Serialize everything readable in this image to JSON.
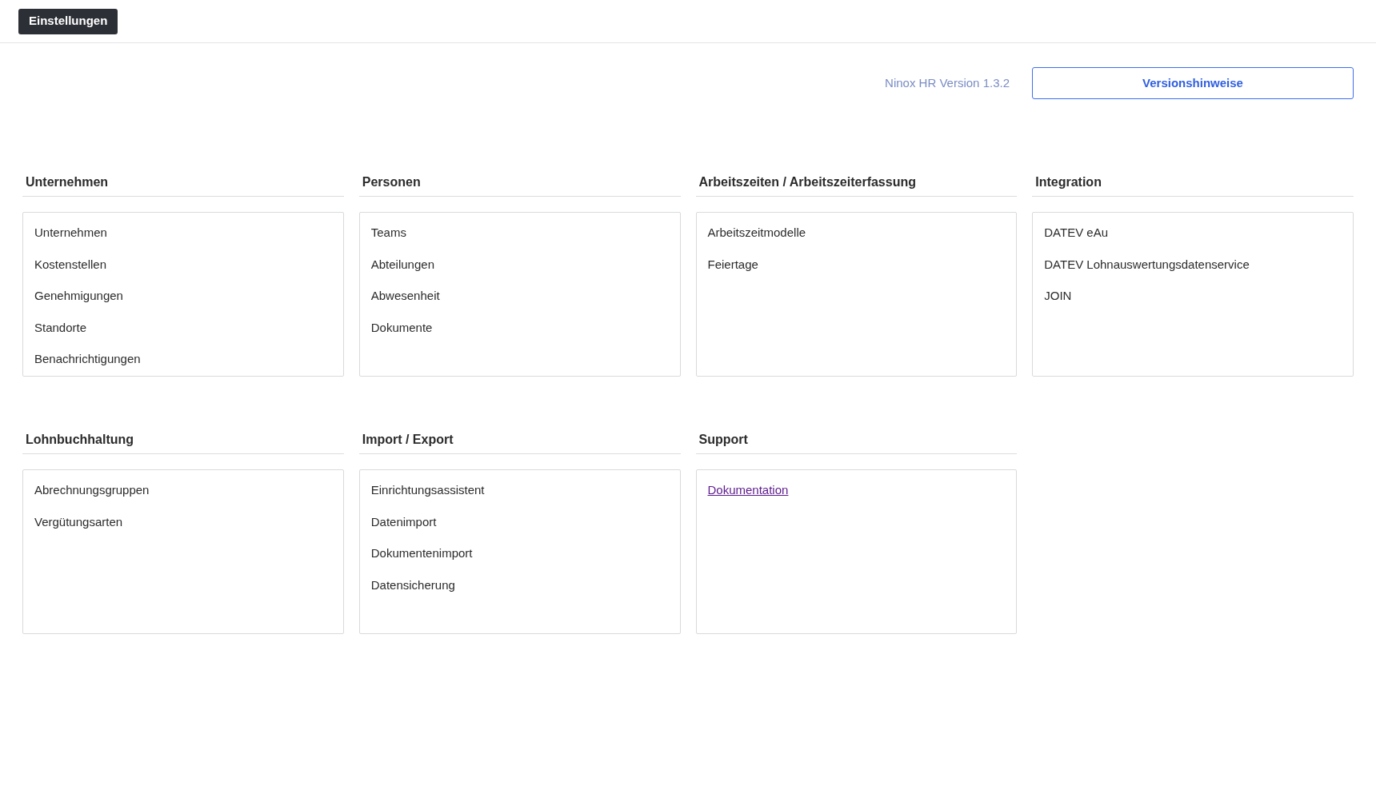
{
  "top_bar": {
    "button": "Einstellungen"
  },
  "version": {
    "text": "Ninox HR Version 1.3.2",
    "button": "Versionshinweise"
  },
  "rows": [
    [
      {
        "title": "Unternehmen",
        "items": [
          {
            "label": "Unternehmen",
            "kind": "text"
          },
          {
            "label": "Kostenstellen",
            "kind": "text"
          },
          {
            "label": "Genehmigungen",
            "kind": "text"
          },
          {
            "label": "Standorte",
            "kind": "text"
          },
          {
            "label": "Benachrichtigungen",
            "kind": "text"
          }
        ]
      },
      {
        "title": "Personen",
        "items": [
          {
            "label": "Teams",
            "kind": "text"
          },
          {
            "label": "Abteilungen",
            "kind": "text"
          },
          {
            "label": "Abwesenheit",
            "kind": "text"
          },
          {
            "label": "Dokumente",
            "kind": "text"
          }
        ]
      },
      {
        "title": "Arbeitszeiten / Arbeitszeiterfassung",
        "items": [
          {
            "label": "Arbeitszeitmodelle",
            "kind": "text"
          },
          {
            "label": "Feiertage",
            "kind": "text"
          }
        ]
      },
      {
        "title": "Integration",
        "items": [
          {
            "label": "DATEV eAu",
            "kind": "text"
          },
          {
            "label": "DATEV Lohnauswertungsdatenservice",
            "kind": "text"
          },
          {
            "label": "JOIN",
            "kind": "text"
          }
        ]
      }
    ],
    [
      {
        "title": "Lohnbuchhaltung",
        "items": [
          {
            "label": "Abrechnungsgruppen",
            "kind": "text"
          },
          {
            "label": "Vergütungsarten",
            "kind": "text"
          }
        ]
      },
      {
        "title": "Import / Export",
        "items": [
          {
            "label": "Einrichtungsassistent",
            "kind": "text"
          },
          {
            "label": "Datenimport",
            "kind": "text"
          },
          {
            "label": "Dokumentenimport",
            "kind": "text"
          },
          {
            "label": "Datensicherung",
            "kind": "text"
          }
        ]
      },
      {
        "title": "Support",
        "items": [
          {
            "label": "Dokumentation",
            "kind": "link"
          }
        ]
      }
    ]
  ]
}
